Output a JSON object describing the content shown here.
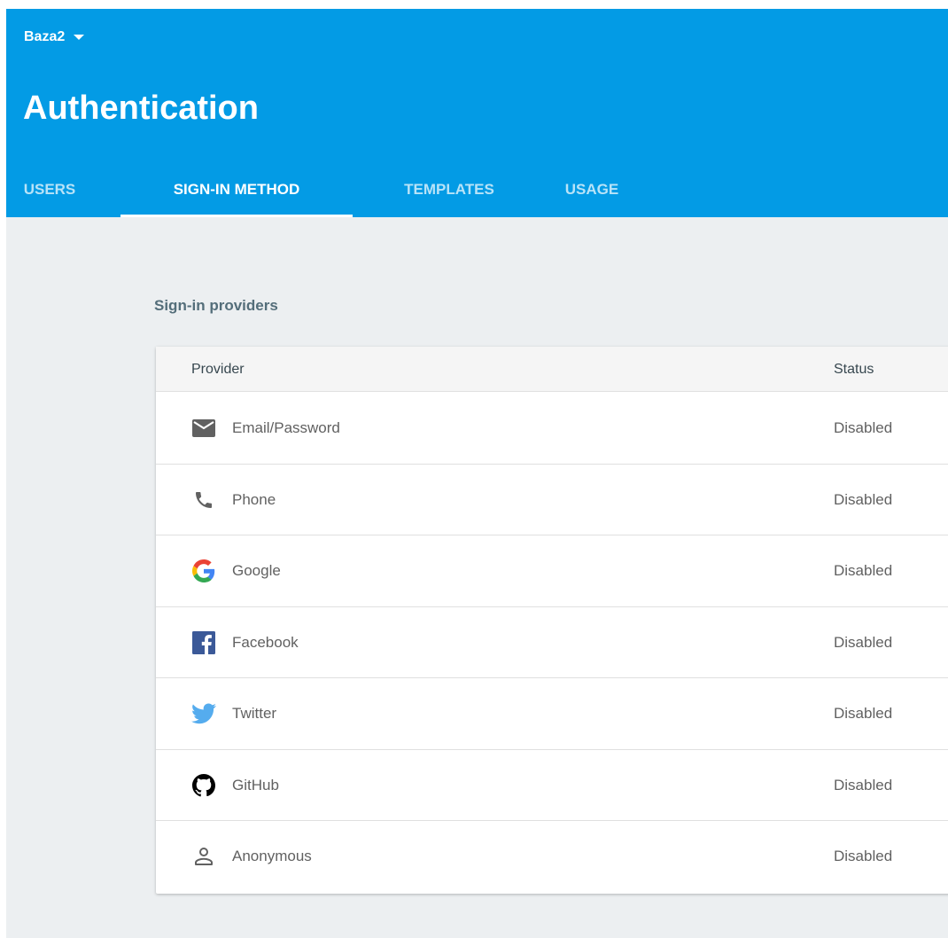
{
  "header": {
    "project_name": "Baza2",
    "title": "Authentication",
    "background_color": "#039be5",
    "tabs": [
      {
        "label": "USERS",
        "active": false
      },
      {
        "label": "SIGN-IN METHOD",
        "active": true
      },
      {
        "label": "TEMPLATES",
        "active": false
      },
      {
        "label": "USAGE",
        "active": false
      }
    ]
  },
  "providers_section": {
    "title": "Sign-in providers",
    "columns": {
      "provider": "Provider",
      "status": "Status"
    },
    "rows": [
      {
        "icon": "email-icon",
        "name": "Email/Password",
        "status": "Disabled"
      },
      {
        "icon": "phone-icon",
        "name": "Phone",
        "status": "Disabled"
      },
      {
        "icon": "google-icon",
        "name": "Google",
        "status": "Disabled"
      },
      {
        "icon": "facebook-icon",
        "name": "Facebook",
        "status": "Disabled"
      },
      {
        "icon": "twitter-icon",
        "name": "Twitter",
        "status": "Disabled"
      },
      {
        "icon": "github-icon",
        "name": "GitHub",
        "status": "Disabled"
      },
      {
        "icon": "anonymous-icon",
        "name": "Anonymous",
        "status": "Disabled"
      }
    ]
  },
  "colors": {
    "page_background": "#eceff1",
    "facebook": "#3b5998",
    "twitter": "#55acee",
    "github": "#000000"
  }
}
